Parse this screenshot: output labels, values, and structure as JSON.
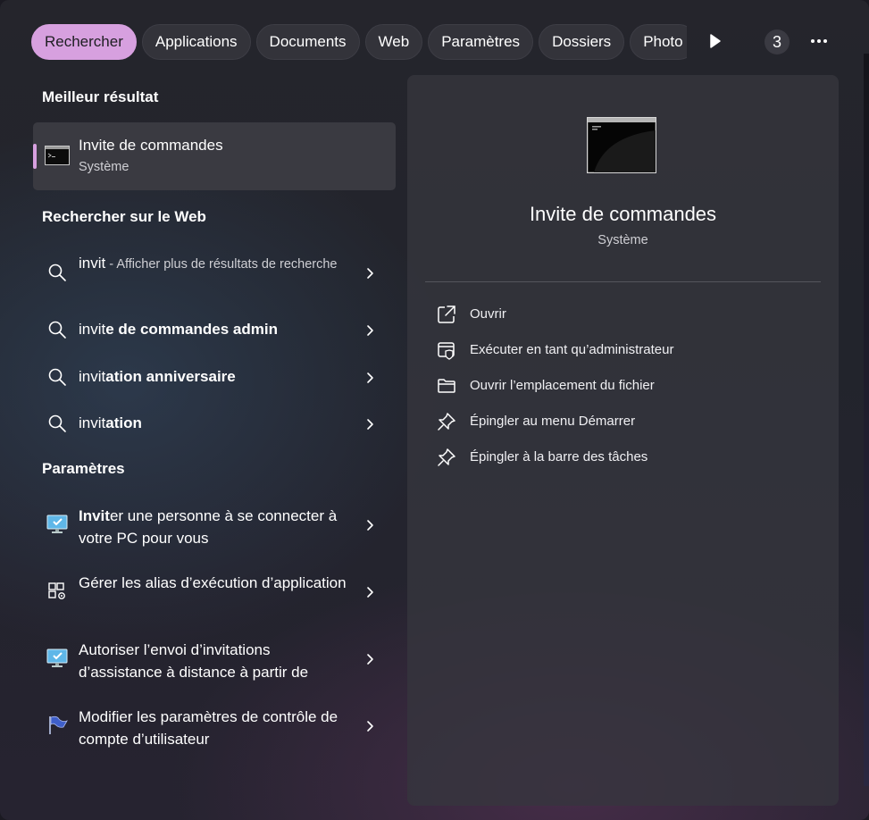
{
  "tabs": [
    "Rechercher",
    "Applications",
    "Documents",
    "Web",
    "Paramètres",
    "Dossiers",
    "Photo"
  ],
  "active_tab": "Rechercher",
  "result_count": "3",
  "best_match": {
    "section": "Meilleur résultat",
    "title": "Invite de commandes",
    "subtitle": "Système"
  },
  "web": {
    "section": "Rechercher sur le Web",
    "items": [
      {
        "typed": "invit",
        "completion": "",
        "hint": " - Afficher plus de résultats de recherche"
      },
      {
        "typed": "invit",
        "completion": "e de commandes admin",
        "hint": ""
      },
      {
        "typed": "invit",
        "completion": "ation anniversaire",
        "hint": ""
      },
      {
        "typed": "invit",
        "completion": "ation",
        "hint": ""
      }
    ]
  },
  "settings": {
    "section": "Paramètres",
    "items": [
      {
        "bold": "Invit",
        "rest": "er une personne à se connecter à votre PC pour vous",
        "icon": "monitor-check-icon"
      },
      {
        "bold": "",
        "rest": "Gérer les alias d’exécution d’application",
        "icon": "app-alias-settings-icon"
      },
      {
        "bold": "",
        "rest": "Autoriser l’envoi d’invitations d’assistance à distance à partir de",
        "icon": "monitor-check-icon"
      },
      {
        "bold": "",
        "rest": "Modifier les paramètres de contrôle de compte d’utilisateur",
        "icon": "uac-flag-icon"
      }
    ]
  },
  "preview": {
    "title": "Invite de commandes",
    "subtitle": "Système",
    "actions": [
      {
        "label": "Ouvrir",
        "icon": "open-external-icon"
      },
      {
        "label": "Exécuter en tant qu’administrateur",
        "icon": "run-as-admin-icon"
      },
      {
        "label": "Ouvrir l’emplacement du fichier",
        "icon": "folder-icon"
      },
      {
        "label": "Épingler au menu Démarrer",
        "icon": "pin-icon"
      },
      {
        "label": "Épingler à la barre des tâches",
        "icon": "pin-icon"
      }
    ]
  },
  "colors": {
    "accent": "#d7a0df",
    "panel": "#36363e",
    "text_secondary": "#cfcfd4"
  }
}
